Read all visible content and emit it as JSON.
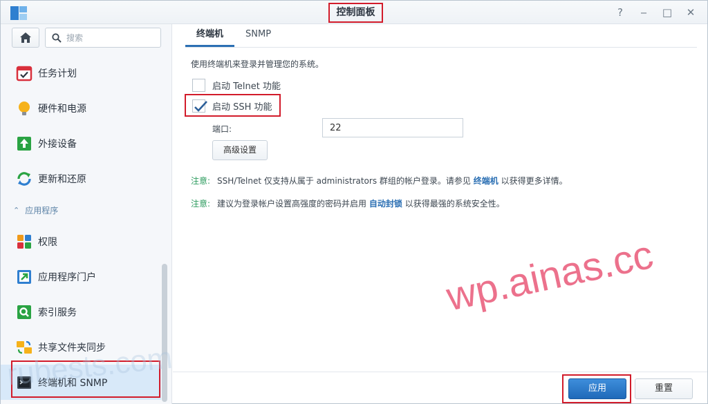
{
  "window": {
    "title": "控制面板",
    "controls": [
      "?",
      "‒",
      "□",
      "✕"
    ]
  },
  "sidebar": {
    "search_placeholder": "搜索",
    "items_top": [
      {
        "label": "任务计划",
        "icon": "task-scheduler-icon"
      },
      {
        "label": "硬件和电源",
        "icon": "lightbulb-icon"
      },
      {
        "label": "外接设备",
        "icon": "external-device-icon"
      },
      {
        "label": "更新和还原",
        "icon": "update-restore-icon"
      }
    ],
    "section_label": "应用程序",
    "items_apps": [
      {
        "label": "权限",
        "icon": "privileges-icon"
      },
      {
        "label": "应用程序门户",
        "icon": "app-portal-icon"
      },
      {
        "label": "索引服务",
        "icon": "indexing-service-icon"
      },
      {
        "label": "共享文件夹同步",
        "icon": "shared-folder-sync-icon"
      },
      {
        "label": "终端机和 SNMP",
        "icon": "terminal-icon"
      }
    ]
  },
  "tabs": [
    {
      "label": "终端机",
      "active": true
    },
    {
      "label": "SNMP",
      "active": false
    }
  ],
  "content": {
    "description": "使用终端机来登录并管理您的系统。",
    "telnet_label": "启动 Telnet 功能",
    "telnet_checked": false,
    "ssh_label": "启动 SSH 功能",
    "ssh_checked": true,
    "port_label": "端口:",
    "port_value": "22",
    "advanced_button": "高级设置",
    "note_label": "注意:",
    "note1_text": "SSH/Telnet 仅支持从属于 administrators 群组的帐户登录。请参见",
    "note1_link": "终端机",
    "note1_tail": "以获得更多详情。",
    "note2_text": "建议为登录帐户设置高强度的密码并启用",
    "note2_link": "自动封锁",
    "note2_tail": "以获得最强的系统安全性。"
  },
  "footer": {
    "apply": "应用",
    "reset": "重置"
  },
  "watermark": "wp.ainas.cc",
  "watermark_faint": "rubests.com",
  "colors": {
    "accent": "#2b6fb3",
    "highlight_outline": "#d21b2a",
    "note_green": "#2c9b5e",
    "watermark": "#e95878"
  }
}
